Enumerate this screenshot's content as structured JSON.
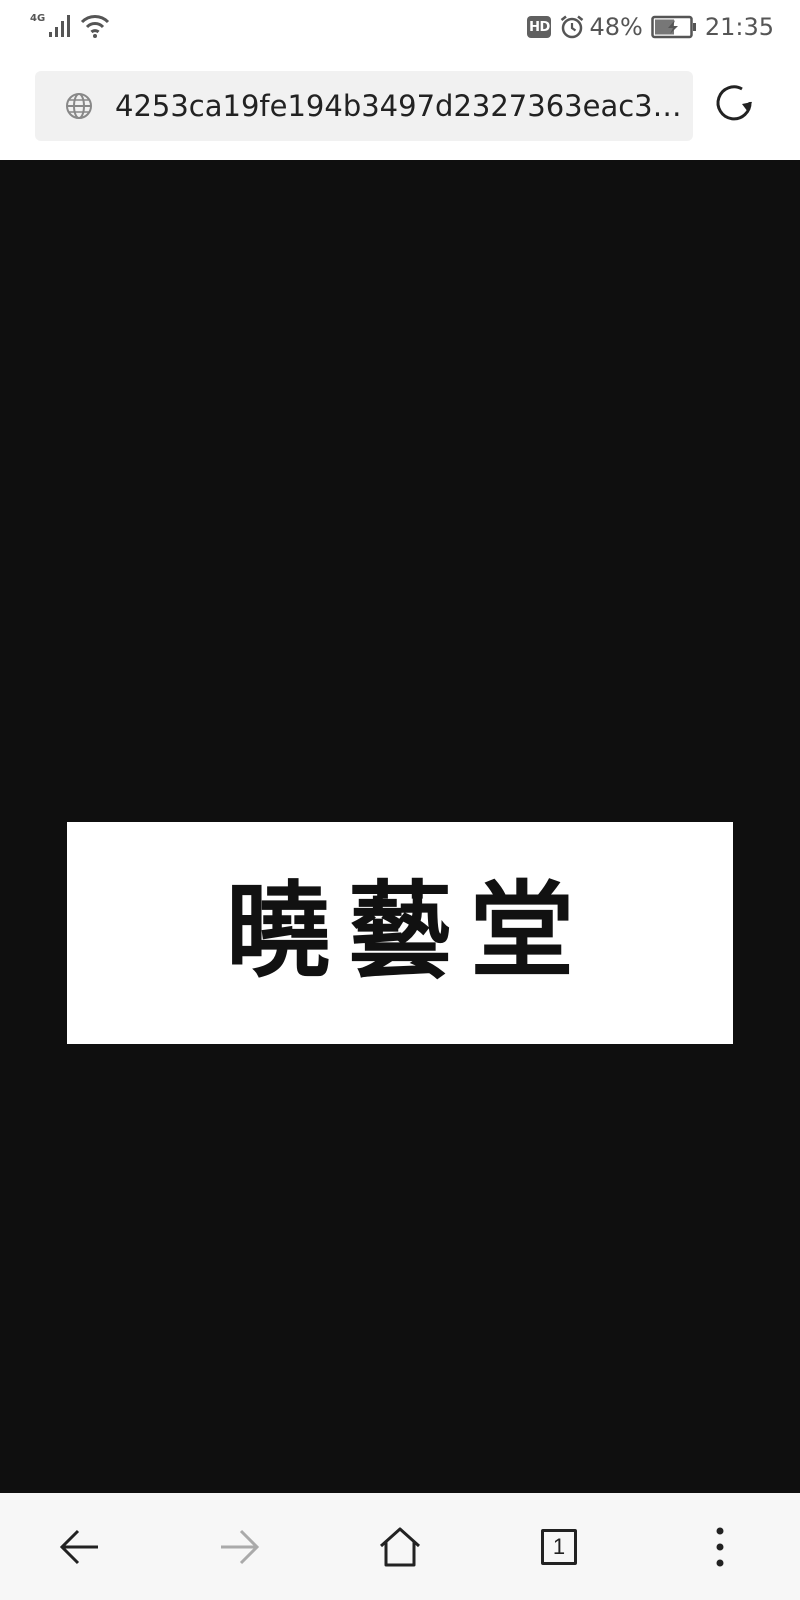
{
  "status_bar": {
    "network": "4G",
    "hd_label": "HD",
    "battery_percent": "48%",
    "time": "21:35",
    "icons": [
      "signal-icon",
      "wifi-icon",
      "alarm-icon",
      "battery-charging-icon"
    ]
  },
  "address_bar": {
    "url": "4253ca19fe194b3497d2327363eac379...",
    "icons": [
      "globe-icon",
      "reload-icon"
    ]
  },
  "content": {
    "logo_text": "曉藝堂",
    "background": "#0f0f0f"
  },
  "nav_bar": {
    "tab_count": "1",
    "icons": [
      "back-arrow-icon",
      "forward-arrow-icon",
      "home-icon",
      "tabs-icon",
      "more-vertical-icon"
    ]
  }
}
